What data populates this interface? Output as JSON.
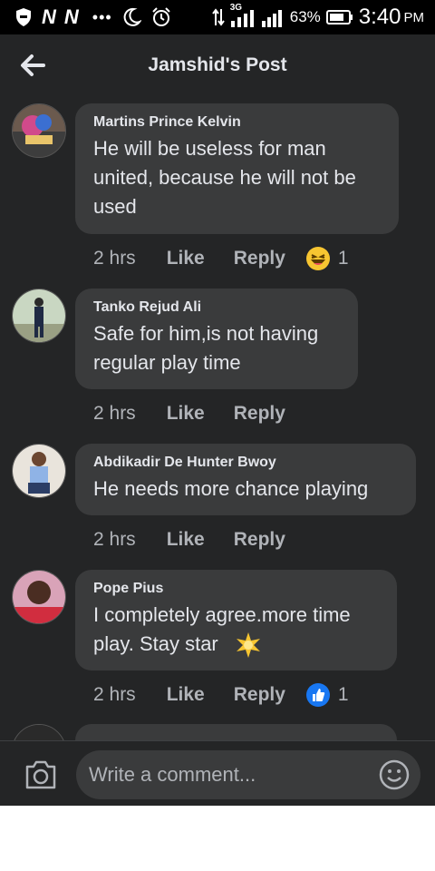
{
  "status_bar": {
    "battery_percent": "63%",
    "time": "3:40",
    "ampm": "PM",
    "network": "3G",
    "icons": [
      "shield-icon",
      "n-icon",
      "n-icon",
      "dots-icon",
      "moon-icon",
      "alarm-icon",
      "data-arrows-icon",
      "signal-icon",
      "signal-icon",
      "battery-icon"
    ]
  },
  "header": {
    "title": "Jamshid's Post",
    "back_icon": "arrow-left-icon"
  },
  "comments": [
    {
      "name": "Martins Prince Kelvin",
      "text_lines": [
        "He will be useless for man",
        "united, because he will not be",
        "used"
      ],
      "time": "2 hrs",
      "like": "Like",
      "reply": "Reply",
      "reaction": "haha",
      "reaction_count": "1"
    },
    {
      "name": "Tanko Rejud Ali",
      "text_lines": [
        "Safe for him,is not having",
        "regular play time"
      ],
      "time": "2 hrs",
      "like": "Like",
      "reply": "Reply"
    },
    {
      "name": "Abdikadir De Hunter Bwoy",
      "text_lines": [
        "He needs more chance playing"
      ],
      "time": "2 hrs",
      "like": "Like",
      "reply": "Reply"
    },
    {
      "name": "Pope Pius",
      "text_lines": [
        "I completely agree.more time",
        "play. Stay star"
      ],
      "time": "2 hrs",
      "like": "Like",
      "reply": "Reply",
      "reaction": "like",
      "reaction_count": "1"
    }
  ],
  "composer": {
    "placeholder": "Write a comment...",
    "camera_icon": "camera-icon",
    "emoji_icon": "smiley-icon"
  },
  "colors": {
    "background": "#242526",
    "bubble": "#3a3b3c",
    "text": "#e4e6eb",
    "secondary": "#b0b3b8",
    "like_blue": "#1877f2",
    "haha_yellow": "#f7c531"
  }
}
